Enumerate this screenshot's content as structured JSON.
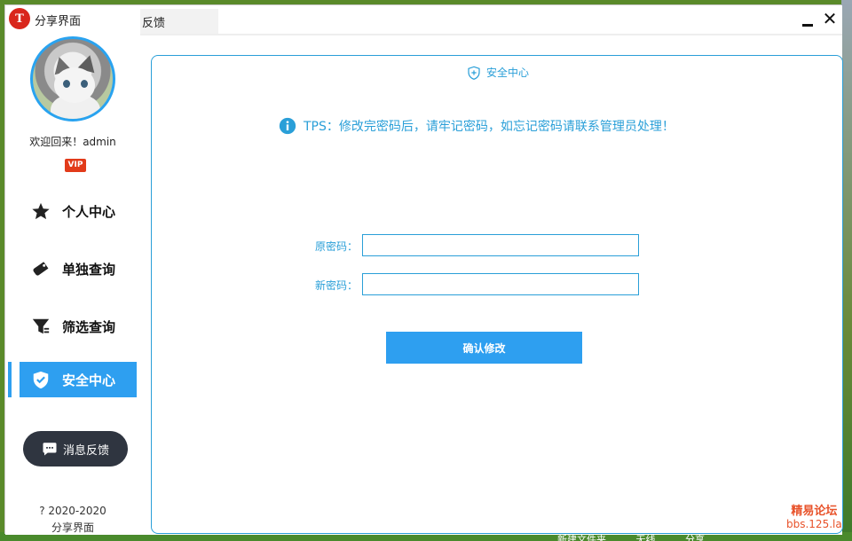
{
  "window": {
    "title": "分享界面",
    "tab_fragment": "反馈",
    "close_glyph": "✕"
  },
  "sidebar": {
    "welcome": "欢迎回来！admin",
    "vip_badge": "VIP",
    "items": [
      {
        "label": "个人中心",
        "icon": "star-icon",
        "active": false
      },
      {
        "label": "单独查询",
        "icon": "tag-icon",
        "active": false
      },
      {
        "label": "筛选查询",
        "icon": "filter-icon",
        "active": false
      },
      {
        "label": "安全中心",
        "icon": "shield-check-icon",
        "active": true
      }
    ],
    "feedback_button": "消息反馈",
    "footer_year": "? 2020-2020",
    "footer_name": "分享界面"
  },
  "main": {
    "panel_title": "安全中心",
    "tips": "TPS：修改完密码后，请牢记密码，如忘记密码请联系管理员处理！",
    "fields": [
      {
        "label": "原密码：",
        "value": "",
        "placeholder": ""
      },
      {
        "label": "新密码：",
        "value": "",
        "placeholder": ""
      }
    ],
    "submit_label": "确认修改"
  },
  "watermark": {
    "line1": "精易论坛",
    "line2": "bbs.125.la"
  },
  "desktop_bottom": [
    "新建文件夹",
    "无线",
    "分享"
  ],
  "colors": {
    "accent": "#2e9ff0",
    "border_blue": "#2a9fd8",
    "dark_button": "#2f3540",
    "vip_red": "#e23b1a",
    "watermark": "#e8522a"
  }
}
